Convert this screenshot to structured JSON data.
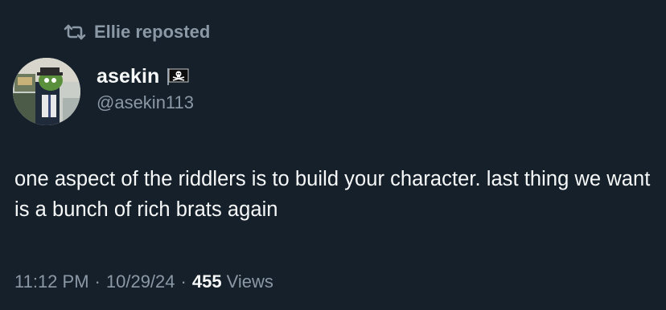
{
  "repost": {
    "icon": "repost-icon",
    "text": "Ellie reposted"
  },
  "author": {
    "avatar_icon": "avatar-image",
    "display_name": "asekin",
    "badge_icon": "pirate-flag-icon",
    "handle": "@asekin113"
  },
  "post": {
    "text": "one aspect of the riddlers is to build your character. last thing we want is a bunch of rich brats again"
  },
  "meta": {
    "time": "11:12 PM",
    "separator": "·",
    "date": "10/29/24",
    "views_count": "455",
    "views_label": "Views"
  },
  "colors": {
    "background": "#15202b",
    "primary_text": "#f7f9f9",
    "secondary_text": "#8b98a5"
  }
}
